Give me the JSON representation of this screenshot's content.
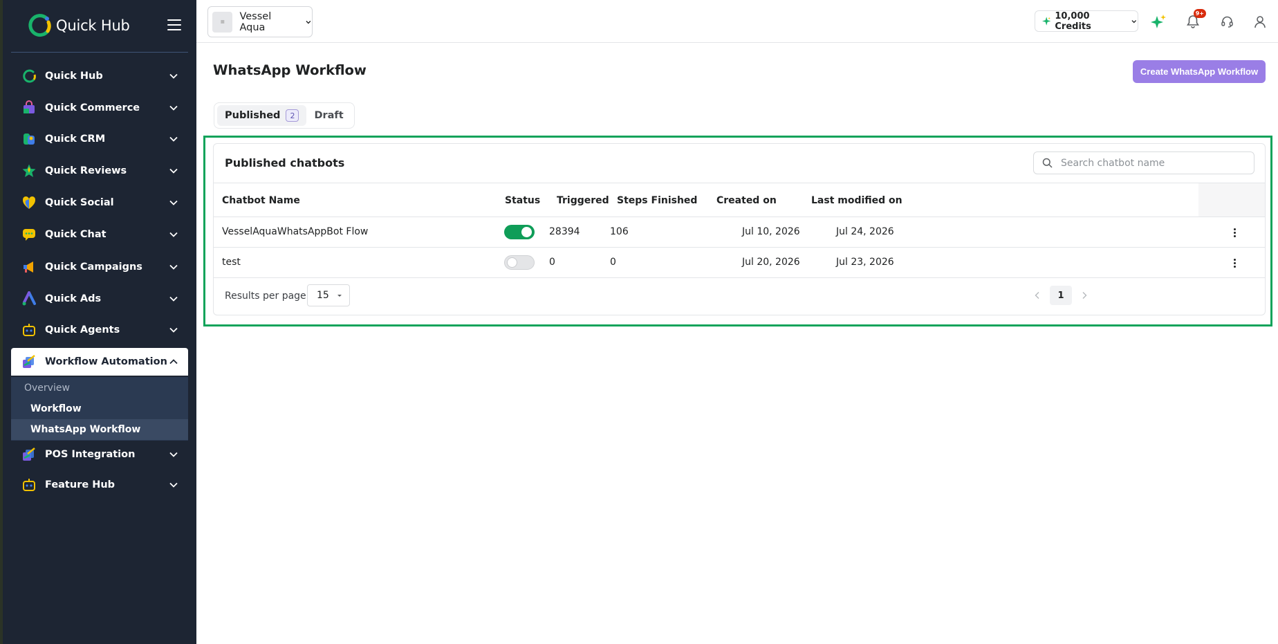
{
  "sidebar": {
    "brand": "Quick Hub",
    "items": [
      {
        "label": "Quick Hub",
        "icon": "quick-hub-icon"
      },
      {
        "label": "Quick Commerce",
        "icon": "shopping-bag-icon"
      },
      {
        "label": "Quick CRM",
        "icon": "crm-icon"
      },
      {
        "label": "Quick Reviews",
        "icon": "star-icon"
      },
      {
        "label": "Quick Social",
        "icon": "heart-shield-icon"
      },
      {
        "label": "Quick Chat",
        "icon": "chat-bubble-icon"
      },
      {
        "label": "Quick Campaigns",
        "icon": "megaphone-icon"
      },
      {
        "label": "Quick Ads",
        "icon": "ads-icon"
      },
      {
        "label": "Quick Agents",
        "icon": "robot-icon"
      },
      {
        "label": "Workflow Automation",
        "icon": "workflow-icon"
      },
      {
        "label": "POS Integration",
        "icon": "pos-icon"
      },
      {
        "label": "Feature Hub",
        "icon": "robot-icon"
      }
    ],
    "submenu": [
      {
        "label": "Overview"
      },
      {
        "label": "Workflow"
      },
      {
        "label": "WhatsApp Workflow"
      }
    ]
  },
  "topbar": {
    "store_name": "Vessel Aqua",
    "credits": "10,000 Credits",
    "notification_badge": "9+"
  },
  "page": {
    "title": "WhatsApp Workflow",
    "create_button": "Create WhatsApp Workflow",
    "tabs": [
      {
        "label": "Published",
        "count": "2"
      },
      {
        "label": "Draft"
      }
    ]
  },
  "card": {
    "title": "Published chatbots",
    "search_placeholder": "Search chatbot name",
    "columns": [
      "Chatbot Name",
      "Status",
      "Triggered",
      "Steps Finished",
      "Created on",
      "Last modified on"
    ],
    "rows": [
      {
        "name": "VesselAquaWhatsAppBot Flow",
        "status": "on",
        "triggered": "28394",
        "steps": "106",
        "created": "Jul 10, 2026",
        "modified": "Jul 24, 2026"
      },
      {
        "name": "test",
        "status": "off",
        "triggered": "0",
        "steps": "0",
        "created": "Jul 20, 2026",
        "modified": "Jul 23, 2026"
      }
    ],
    "results_per_page_label": "Results per page",
    "results_per_page_value": "15",
    "current_page": "1"
  },
  "colors": {
    "sidebar_bg": "#1d2533",
    "accent_purple": "#9a7ee6",
    "toggle_on": "#0f9d58",
    "highlight_green": "#10a35a"
  }
}
